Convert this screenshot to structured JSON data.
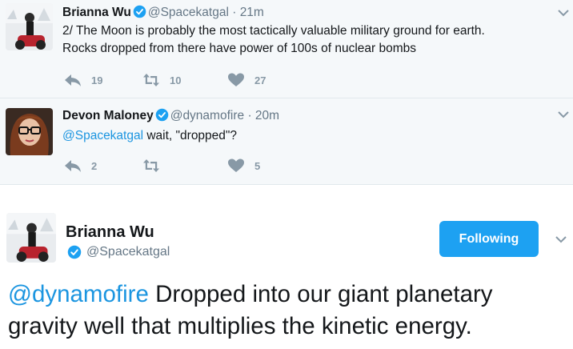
{
  "tweet1": {
    "name": "Brianna Wu",
    "handle": "@Spacekatgal",
    "separator": "·",
    "time": "21m",
    "text_line1": "2/ The Moon is probably the most tactically valuable military ground for earth.",
    "text_line2": "Rocks dropped from there have power of 100s of nuclear bombs",
    "reply_count": "19",
    "retweet_count": "10",
    "like_count": "27"
  },
  "tweet2": {
    "name": "Devon Maloney",
    "handle": "@dynamofire",
    "separator": "·",
    "time": "20m",
    "mention": "@Spacekatgal",
    "text": " wait, \"dropped\"?",
    "reply_count": "2",
    "retweet_count": "",
    "like_count": "5"
  },
  "main_tweet": {
    "name": "Brianna Wu",
    "handle": "@Spacekatgal",
    "follow_label": "Following",
    "mention": "@dynamofire",
    "text_line1": " Dropped into our giant planetary",
    "text_line2": "gravity well that multiplies the kinetic energy."
  },
  "colors": {
    "accent": "#1da1f2",
    "mention": "#1b95e0",
    "muted": "#657786",
    "action_icon": "#8899a6",
    "compact_bg": "#f5f8fa"
  },
  "icons": [
    "verified-badge-icon",
    "reply-icon",
    "retweet-icon",
    "heart-icon",
    "chevron-down-icon"
  ]
}
